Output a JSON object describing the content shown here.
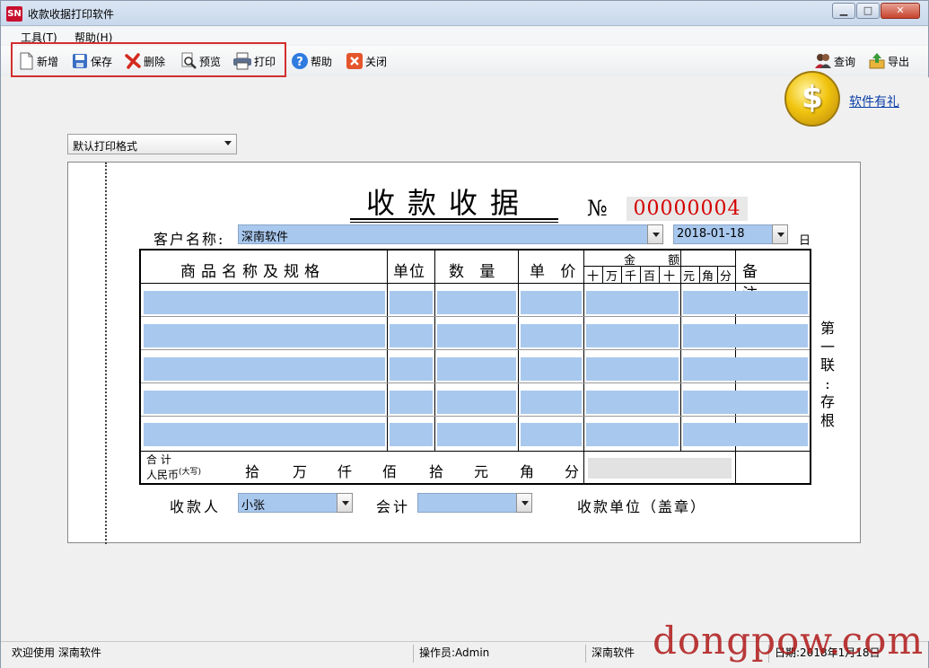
{
  "app": {
    "icon_text": "SN",
    "title": "收款收据打印软件"
  },
  "menu": [
    {
      "label": "工具(T)"
    },
    {
      "label": "帮助(H)"
    }
  ],
  "toolbar": {
    "new": "新增",
    "save": "保存",
    "delete": "删除",
    "preview": "预览",
    "print": "打印",
    "help": "帮助",
    "close": "关闭",
    "query": "查询",
    "export": "导出"
  },
  "promo": {
    "link": "软件有礼",
    "coin_symbol": "$"
  },
  "format_select": {
    "value": "默认打印格式"
  },
  "receipt": {
    "title": "收款收据",
    "no_label": "№",
    "no_value": "00000004",
    "customer_label": "客户名称:",
    "customer_value": "深南软件",
    "date_value": "2018-01-18",
    "day_label": "日",
    "headers": {
      "product": "商品名称及规格",
      "unit": "单位",
      "qty": "数 量",
      "price": "单 价",
      "amount": "金  额",
      "amount_digits": [
        "十",
        "万",
        "千",
        "百",
        "十",
        "元",
        "角",
        "分"
      ],
      "remark": "备 注"
    },
    "total_label_line1": "合 计",
    "total_label_line2": "人民币",
    "total_daxie": "(大写)",
    "total_units": [
      "拾",
      "万",
      "仟",
      "佰",
      "拾",
      "元",
      "角",
      "分"
    ],
    "side_text": [
      "第",
      "一",
      "联",
      ":",
      "存",
      "根"
    ],
    "payee_label": "收款人",
    "payee_value": "小张",
    "accountant_label": "会计",
    "accountant_value": "",
    "unit_stamp_label": "收款单位（盖章）"
  },
  "status": {
    "welcome": "欢迎使用  深南软件",
    "operator": "操作员:Admin",
    "company": "深南软件",
    "date_partial": "日期:2018年1月18日"
  },
  "watermark": "dongpow.com",
  "colors": {
    "field_blue": "#a9c8ee",
    "number_red": "#d40000",
    "highlight_red": "#d32f2f"
  }
}
